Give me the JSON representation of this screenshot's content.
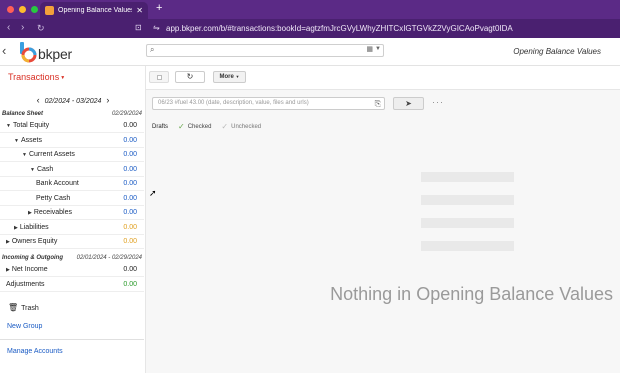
{
  "browser": {
    "tab_title": "Opening Balance Values – Tra",
    "url": "app.bkper.com/b/#transactions:bookId=agtzfmJrcGVyLWhyZHITCxIGTGVkZ2VyGICAoPvagt0IDA"
  },
  "app": {
    "brand": "bkper",
    "book_title": "Opening Balance Values"
  },
  "sidebar": {
    "transactions_menu": "Transactions",
    "period": "02/2024 - 03/2024",
    "balance_sheet": {
      "title": "Balance Sheet",
      "date": "02/29/2024",
      "rows": [
        {
          "label": "Total Equity",
          "value": "0.00",
          "indent": 6,
          "arrow": "down",
          "color": "black"
        },
        {
          "label": "Assets",
          "value": "0.00",
          "indent": 14,
          "arrow": "down",
          "color": "blue"
        },
        {
          "label": "Current Assets",
          "value": "0.00",
          "indent": 22,
          "arrow": "down",
          "color": "blue"
        },
        {
          "label": "Cash",
          "value": "0.00",
          "indent": 30,
          "arrow": "down",
          "color": "blue"
        },
        {
          "label": "Bank Account",
          "value": "0.00",
          "indent": 36,
          "arrow": "",
          "color": "blue"
        },
        {
          "label": "Petty Cash",
          "value": "0.00",
          "indent": 36,
          "arrow": "",
          "color": "blue"
        },
        {
          "label": "Receivables",
          "value": "0.00",
          "indent": 28,
          "arrow": "right",
          "color": "blue"
        },
        {
          "label": "Liabilities",
          "value": "0.00",
          "indent": 14,
          "arrow": "right",
          "color": "orange"
        },
        {
          "label": "Owners Equity",
          "value": "0.00",
          "indent": 6,
          "arrow": "right",
          "color": "orange"
        }
      ]
    },
    "incoming_outgoing": {
      "title": "Incoming & Outgoing",
      "date": "02/01/2024 - 02/29/2024",
      "rows": [
        {
          "label": "Net Income",
          "value": "0.00",
          "indent": 6,
          "arrow": "right",
          "color": "black"
        },
        {
          "label": "Adjustments",
          "value": "0.00",
          "indent": 6,
          "arrow": "",
          "color": "green"
        }
      ]
    },
    "trash": "Trash",
    "new_group": "New Group",
    "manage_accounts": "Manage Accounts"
  },
  "toolbar": {
    "more_label": "More"
  },
  "entry": {
    "placeholder": "06/23 #fuel 43.00 (date, description, value, files and urls)"
  },
  "filters": {
    "drafts": "Drafts",
    "checked": "Checked",
    "unchecked": "Unchecked"
  },
  "empty_state": "Nothing in Opening Balance Values",
  "colors": {
    "black": "#222222",
    "blue": "#1a5bc4",
    "orange": "#e0a020",
    "green": "#2a9a2a",
    "brand_red": "#d93025",
    "browser_purple": "#5b2a86"
  }
}
